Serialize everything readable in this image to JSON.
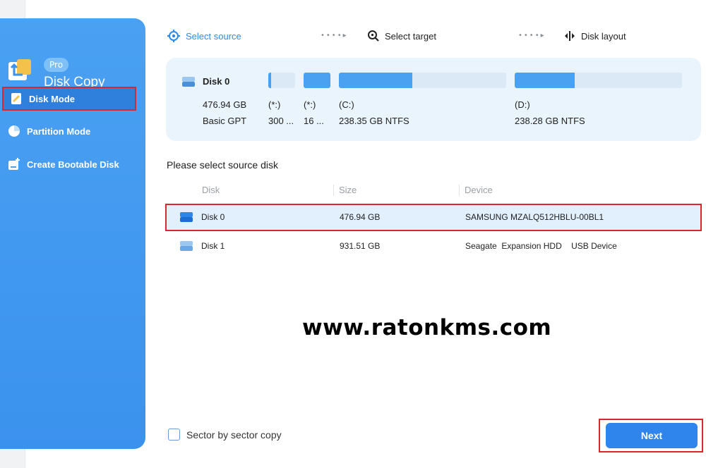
{
  "brand": {
    "badge": "Pro",
    "title": "Disk Copy"
  },
  "sidebar": {
    "items": [
      {
        "label": "Disk Mode",
        "icon": "disk-mode-icon",
        "active": true
      },
      {
        "label": "Partition Mode",
        "icon": "pie-chart-icon",
        "active": false
      },
      {
        "label": "Create Bootable Disk",
        "icon": "bootable-disk-icon",
        "active": false
      }
    ]
  },
  "steps": [
    {
      "label": "Select source",
      "icon": "target-icon",
      "active": true
    },
    {
      "label": "Select target",
      "icon": "search-target-icon",
      "active": false
    },
    {
      "label": "Disk layout",
      "icon": "split-layout-icon",
      "active": false
    }
  ],
  "step_separator": "••••▸",
  "disk_panel": {
    "name": "Disk 0",
    "size": "476.94 GB",
    "style": "Basic GPT",
    "partitions": [
      {
        "label": "(*:)",
        "info": "300 ...",
        "used_fraction": 0.1
      },
      {
        "label": "(*:)",
        "info": "16 ...",
        "used_fraction": 1.0
      },
      {
        "label": "(C:)",
        "info": "238.35 GB NTFS",
        "used_fraction": 0.44
      },
      {
        "label": "(D:)",
        "info": "238.28 GB NTFS",
        "used_fraction": 0.36
      }
    ]
  },
  "source": {
    "title": "Please select source disk",
    "columns": [
      "Disk",
      "Size",
      "Device"
    ],
    "rows": [
      {
        "disk": "Disk 0",
        "size": "476.94 GB",
        "device": "SAMSUNG MZALQ512HBLU-00BL1",
        "selected": true
      },
      {
        "disk": "Disk 1",
        "size": "931.51 GB",
        "device": "Seagate  Expansion HDD    USB Device",
        "selected": false
      }
    ]
  },
  "watermark": "www.ratonkms.com",
  "footer": {
    "sector_label": "Sector by sector copy",
    "sector_checked": false,
    "next_label": "Next"
  },
  "colors": {
    "accent": "#2f85ec",
    "sidebar": "#4aa1f2",
    "highlight": "#d7282f",
    "panel": "#eaf4fd"
  }
}
